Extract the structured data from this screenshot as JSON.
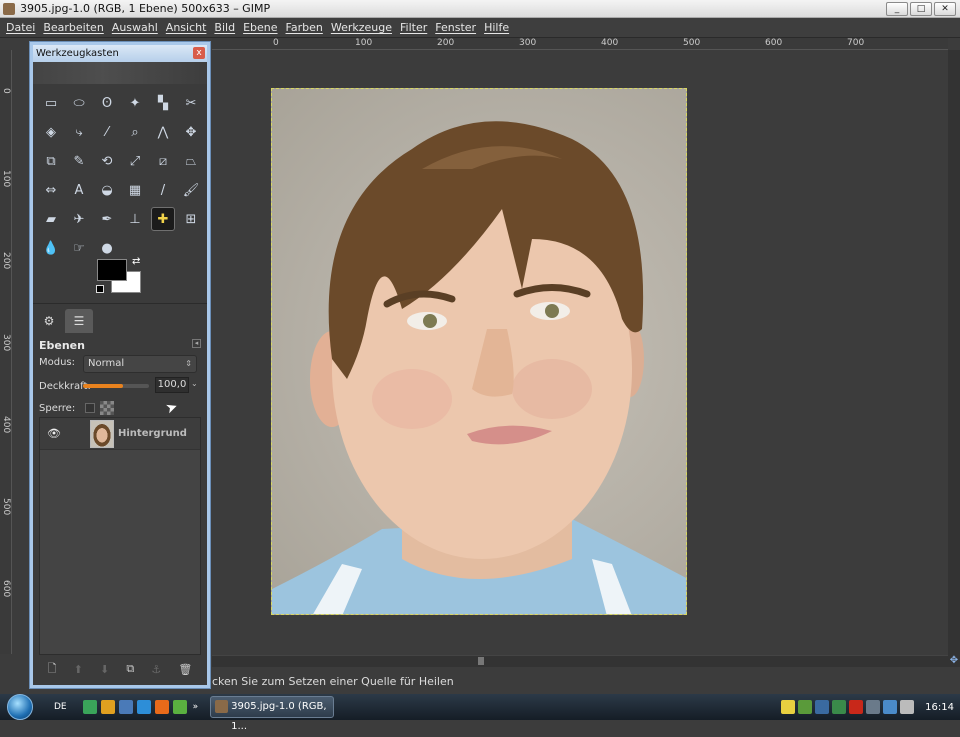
{
  "window": {
    "title": "3905.jpg-1.0 (RGB, 1 Ebene) 500x633 – GIMP",
    "buttons": {
      "minimize": "_",
      "maximize": "□",
      "close": "✕"
    }
  },
  "menu": [
    "Datei",
    "Bearbeiten",
    "Auswahl",
    "Ansicht",
    "Bild",
    "Ebene",
    "Farben",
    "Werkzeuge",
    "Filter",
    "Fenster",
    "Hilfe"
  ],
  "ruler": {
    "h_labels": [
      "0",
      "100",
      "200",
      "300",
      "400",
      "500",
      "600",
      "700"
    ],
    "v_labels": [
      "0",
      "100",
      "200",
      "300",
      "400",
      "500",
      "600"
    ]
  },
  "toolbox": {
    "title": "Werkzeugkasten",
    "close": "x",
    "tools": [
      {
        "name": "rect-select-icon",
        "glyph": "▭"
      },
      {
        "name": "ellipse-select-icon",
        "glyph": "⬭"
      },
      {
        "name": "lasso-icon",
        "glyph": "ʘ"
      },
      {
        "name": "fuzzy-select-icon",
        "glyph": "✦"
      },
      {
        "name": "color-select-icon",
        "glyph": "▚"
      },
      {
        "name": "scissors-icon",
        "glyph": "✂"
      },
      {
        "name": "foreground-select-icon",
        "glyph": "◈"
      },
      {
        "name": "paths-icon",
        "glyph": "⤷"
      },
      {
        "name": "color-picker-icon",
        "glyph": "⁄"
      },
      {
        "name": "zoom-icon",
        "glyph": "⌕"
      },
      {
        "name": "measure-icon",
        "glyph": "⋀"
      },
      {
        "name": "move-icon",
        "glyph": "✥"
      },
      {
        "name": "align-icon",
        "glyph": "⧉"
      },
      {
        "name": "crop-icon",
        "glyph": "✎"
      },
      {
        "name": "rotate-icon",
        "glyph": "⟲"
      },
      {
        "name": "scale-icon",
        "glyph": "⤢"
      },
      {
        "name": "shear-icon",
        "glyph": "⧄"
      },
      {
        "name": "perspective-icon",
        "glyph": "⏢"
      },
      {
        "name": "flip-icon",
        "glyph": "⇔"
      },
      {
        "name": "text-icon",
        "glyph": "A"
      },
      {
        "name": "bucket-fill-icon",
        "glyph": "◒"
      },
      {
        "name": "blend-icon",
        "glyph": "▦"
      },
      {
        "name": "pencil-icon",
        "glyph": "/"
      },
      {
        "name": "paintbrush-icon",
        "glyph": "🖌"
      },
      {
        "name": "eraser-icon",
        "glyph": "▰"
      },
      {
        "name": "airbrush-icon",
        "glyph": "✈"
      },
      {
        "name": "ink-icon",
        "glyph": "✒"
      },
      {
        "name": "clone-icon",
        "glyph": "⊥"
      },
      {
        "name": "heal-icon",
        "glyph": "✚",
        "active": true
      },
      {
        "name": "perspective-clone-icon",
        "glyph": "⊞"
      },
      {
        "name": "blur-icon",
        "glyph": "💧"
      },
      {
        "name": "smudge-icon",
        "glyph": "☞"
      },
      {
        "name": "dodge-burn-icon",
        "glyph": "●"
      }
    ],
    "colors": {
      "foreground": "#000000",
      "background": "#ffffff"
    }
  },
  "layers": {
    "title": "Ebenen",
    "mode_label": "Modus:",
    "mode_value": "Normal",
    "opacity_label": "Deckkraft:",
    "opacity_value": "100,0",
    "opacity_fraction": 1.0,
    "lock_label": "Sperre:",
    "layer_name": "Hintergrund"
  },
  "status": {
    "text": "cken Sie zum Setzen einer Quelle für Heilen"
  },
  "taskbar": {
    "lang": "DE",
    "task_label": "3905.jpg-1.0 (RGB, 1...",
    "clock": "16:14",
    "more": "»"
  },
  "colors": {
    "accent": "#a9c8ea",
    "slider": "#e8821e",
    "selection": "#d8d860"
  }
}
